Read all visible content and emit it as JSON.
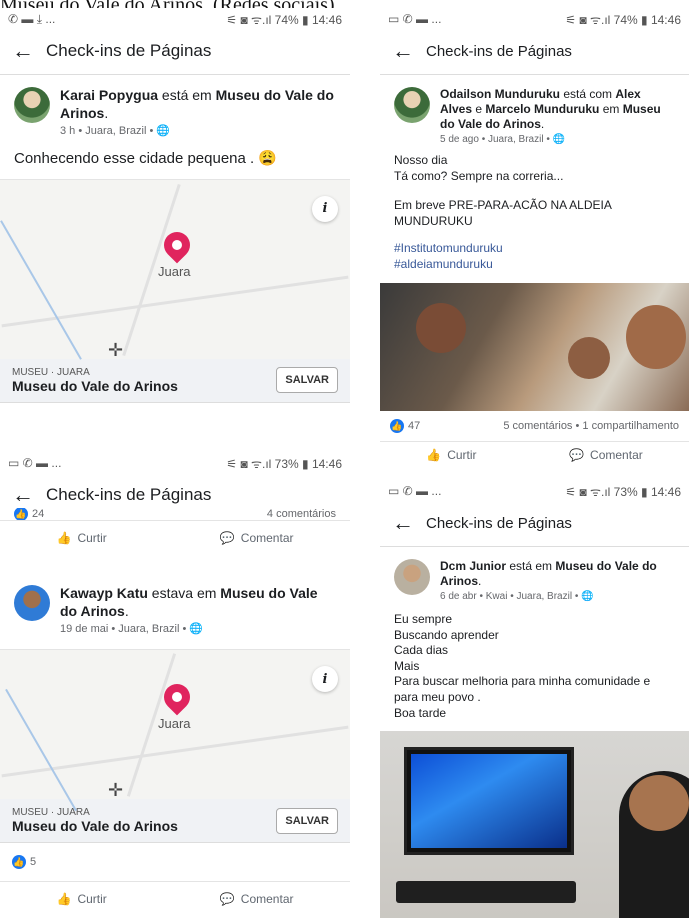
{
  "caption": "Museu do Vale do Arinos. (Redes sociais).",
  "panels": [
    {
      "status": {
        "left": "✆ ▬ ⤓ ...",
        "right": "⚟ ◙ ᯤ.ıl 74% ▮ 14:46"
      },
      "header": "Check-ins de Páginas",
      "post": {
        "author": "Karai Popygua",
        "verb": " está em ",
        "place": "Museu do Vale do Arinos",
        "meta": "3 h • Juara, Brazil • 🌐",
        "text": "Conhecendo esse cidade pequena . 😩"
      },
      "map": {
        "city": "Juara",
        "info": "i"
      },
      "place_card": {
        "small": "MUSEU · JUARA",
        "name": "Museu do Vale do Arinos",
        "button": "SALVAR"
      }
    },
    {
      "status": {
        "left": "▭ ✆ ▬ ...",
        "right": "⚟ ◙ ᯤ.ıl 74% ▮ 14:46"
      },
      "header": "Check-ins de Páginas",
      "post": {
        "author": "Odailson Munduruku",
        "verb": " está com ",
        "with1": "Alex Alves",
        "and": " e ",
        "with2": "Marcelo Munduruku",
        "in": " em ",
        "place": "Museu do Vale do Arinos",
        "meta": "5 de ago • Juara, Brazil • 🌐",
        "lines": [
          "Nosso dia",
          "Tá como? Sempre na correria...",
          "",
          "Em breve PRE-PARA-ACÃO NA ALDEIA MUNDURUKU",
          ""
        ],
        "hashtags": [
          "#Institutomunduruku",
          "#aldeiamunduruku"
        ]
      },
      "reactions": {
        "count": "47",
        "summary": "5 comentários • 1 compartilhamento"
      },
      "actions": {
        "like": "Curtir",
        "comment": "Comentar"
      }
    },
    {
      "status": {
        "left": "▭ ✆ ▬ ...",
        "right": "⚟ ◙ ᯤ.ıl 73% ▮ 14:46"
      },
      "header": "Check-ins de Páginas",
      "partial": {
        "left": "24",
        "right": "4 comentários"
      },
      "actions": {
        "like": "Curtir",
        "comment": "Comentar"
      },
      "post": {
        "author": "Kawayp Katu",
        "verb": " estava em ",
        "place": "Museu do Vale do Arinos",
        "meta": "19 de mai • Juara, Brazil • 🌐"
      },
      "map": {
        "city": "Juara",
        "info": "i"
      },
      "place_card": {
        "small": "MUSEU · JUARA",
        "name": "Museu do Vale do Arinos",
        "button": "SALVAR"
      },
      "reactions": {
        "count": "5"
      },
      "actions2": {
        "like": "Curtir",
        "comment": "Comentar"
      }
    },
    {
      "status": {
        "left": "▭ ✆ ▬ ...",
        "right": "⚟ ◙ ᯤ.ıl 73% ▮ 14:46"
      },
      "header": "Check-ins de Páginas",
      "post": {
        "author": "Dcm Junior",
        "verb": " está em ",
        "place": "Museu do Vale do Arinos",
        "meta": "6 de abr • Kwai • Juara, Brazil • 🌐",
        "lines": [
          "Eu sempre",
          "Buscando aprender",
          "Cada dias",
          "Mais",
          "Para buscar melhoria para minha comunidade e para meu povo .",
          "Boa tarde"
        ]
      }
    }
  ]
}
